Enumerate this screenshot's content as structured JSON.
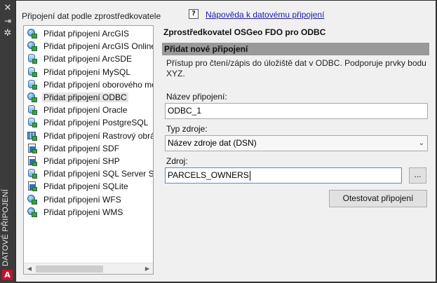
{
  "palette": {
    "title": "DATOVÉ PŘIPOJENÍ",
    "icons": [
      "close-icon",
      "pin-icon",
      "settings-icon"
    ],
    "logo": "A"
  },
  "left_panel": {
    "title": "Připojení dat podle zprostředkovatele",
    "items": [
      {
        "label": "Přidat připojení ArcGIS",
        "icon": "globe-icon"
      },
      {
        "label": "Přidat připojení ArcGIS Online",
        "icon": "globe-icon"
      },
      {
        "label": "Přidat připojení ArcSDE",
        "icon": "database-icon"
      },
      {
        "label": "Přidat připojení MySQL",
        "icon": "database-icon"
      },
      {
        "label": "Přidat připojení oborového mo",
        "icon": "database-icon"
      },
      {
        "label": "Přidat připojení ODBC",
        "icon": "globe-icon",
        "selected": true
      },
      {
        "label": "Přidat připojení Oracle",
        "icon": "database-icon"
      },
      {
        "label": "Přidat připojení PostgreSQL",
        "icon": "database-icon"
      },
      {
        "label": "Přidat připojení Rastrový obráz",
        "icon": "raster-icon"
      },
      {
        "label": "Přidat připojení SDF",
        "icon": "file-icon"
      },
      {
        "label": "Přidat připojení SHP",
        "icon": "file-icon"
      },
      {
        "label": "Přidat připojení SQL Server Spa",
        "icon": "database-icon"
      },
      {
        "label": "Přidat připojení SQLite",
        "icon": "file-icon"
      },
      {
        "label": "Přidat připojení WFS",
        "icon": "globe-icon"
      },
      {
        "label": "Přidat připojení WMS",
        "icon": "globe-icon"
      }
    ]
  },
  "help": {
    "icon": "?",
    "link": "Nápověda k datovému připojení"
  },
  "form": {
    "provider_title": "Zprostředkovatel OSGeo FDO pro ODBC",
    "section_header": "Přidat nové připojení",
    "description": "Přístup pro čtení/zápis do úložiště dat v ODBC. Podporuje prvky bodu XYZ.",
    "name_label": "Název připojení:",
    "name_value": "ODBC_1",
    "source_type_label": "Typ zdroje:",
    "source_type_value": "Název zdroje dat (DSN)",
    "source_label": "Zdroj:",
    "source_value": "PARCELS_OWNERS",
    "browse_label": "...",
    "test_button": "Otestovat připojení"
  }
}
